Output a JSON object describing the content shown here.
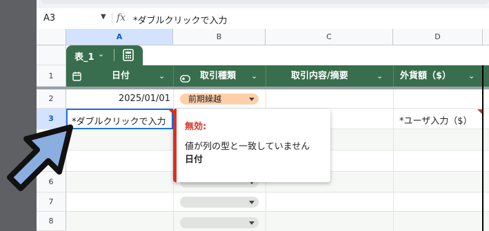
{
  "formula_bar": {
    "cell_ref": "A3",
    "fx_symbol": "fx",
    "value": "*ダブルクリックで入力"
  },
  "column_headers": [
    "A",
    "B",
    "C",
    "D"
  ],
  "row_headers": [
    "1",
    "2",
    "3",
    "6",
    "7",
    "8"
  ],
  "table": {
    "tab_name": "表_1",
    "columns": [
      {
        "label": "日付",
        "icon": "calendar-icon"
      },
      {
        "label": "取引種類",
        "icon": "dropdown-chip-icon"
      },
      {
        "label": "取引内容/摘要",
        "icon": ""
      },
      {
        "label": "外貨額（$）",
        "icon": ""
      }
    ]
  },
  "rows": {
    "row2": {
      "date": "2025/01/01",
      "type": "前期繰越"
    },
    "row3": {
      "date": "*ダブルクリックで入力",
      "amount": "*ユーザ入力（$）"
    }
  },
  "popup": {
    "title": "無効:",
    "message": "値が列の型と一致していません",
    "field": "日付"
  },
  "colors": {
    "table_header": "#386e4d",
    "chip_orange": "#ffcfab",
    "chip_gray": "#e1e3e1",
    "error": "#d93025",
    "selection": "#1a73e8",
    "pointer_arrow": "#8aaee0"
  }
}
